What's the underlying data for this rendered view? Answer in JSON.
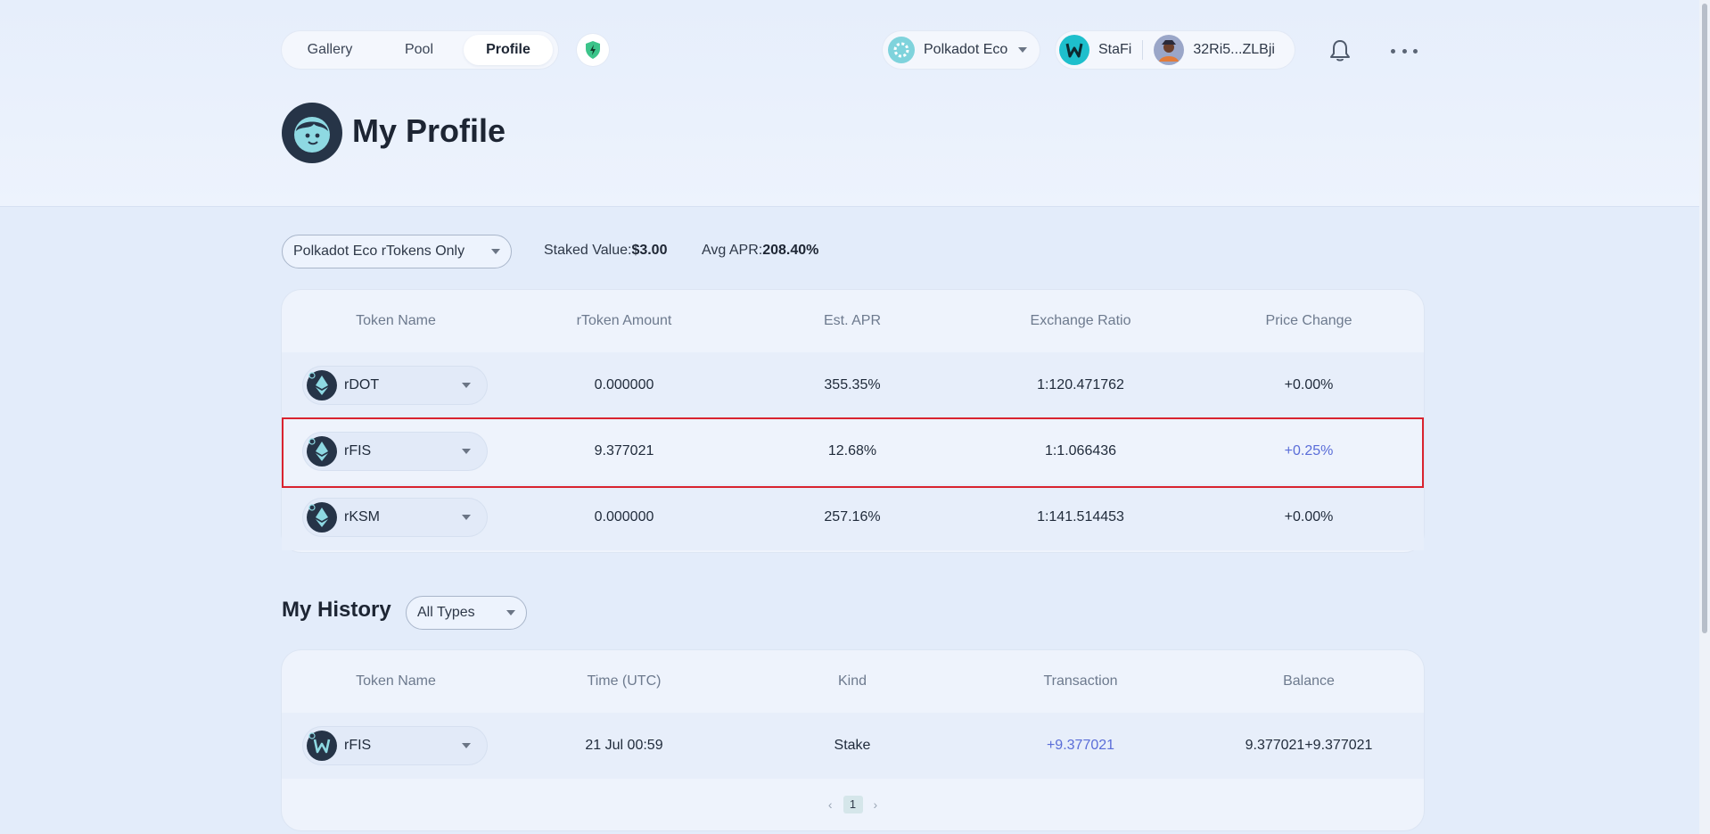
{
  "nav": {
    "tabs": [
      {
        "label": "Gallery"
      },
      {
        "label": "Pool"
      },
      {
        "label": "Profile",
        "active": true
      }
    ]
  },
  "header": {
    "network_label": "Polkadot Eco",
    "wallet_brand": "StaFi",
    "wallet_address": "32Ri5...ZLBji"
  },
  "page": {
    "title": "My Profile"
  },
  "filter": {
    "selected": "Polkadot Eco rTokens Only",
    "staked_label": "Staked Value:",
    "staked_value": "$3.00",
    "apr_label": "Avg APR:",
    "apr_value": "208.40%"
  },
  "tokens_table": {
    "columns": [
      "Token Name",
      "rToken Amount",
      "Est. APR",
      "Exchange Ratio",
      "Price Change"
    ],
    "rows": [
      {
        "token": "rDOT",
        "amount": "0.000000",
        "apr": "355.35%",
        "ratio": "1:120.471762",
        "change": "+0.00%"
      },
      {
        "token": "rFIS",
        "amount": "9.377021",
        "apr": "12.68%",
        "ratio": "1:1.066436",
        "change": "+0.25%"
      },
      {
        "token": "rKSM",
        "amount": "0.000000",
        "apr": "257.16%",
        "ratio": "1:141.514453",
        "change": "+0.00%"
      }
    ]
  },
  "history": {
    "title": "My History",
    "type_filter": "All Types",
    "columns": [
      "Token Name",
      "Time (UTC)",
      "Kind",
      "Transaction",
      "Balance"
    ],
    "rows": [
      {
        "token": "rFIS",
        "time": "21 Jul 00:59",
        "kind": "Stake",
        "transaction": "+9.377021",
        "balance": "9.377021+9.377021"
      }
    ],
    "pagination": {
      "prev": "‹",
      "current": "1",
      "next": "›"
    }
  },
  "colors": {
    "accent_link": "#5a6dd8",
    "highlight": "#d9232f",
    "background": "#e3ecfa"
  }
}
